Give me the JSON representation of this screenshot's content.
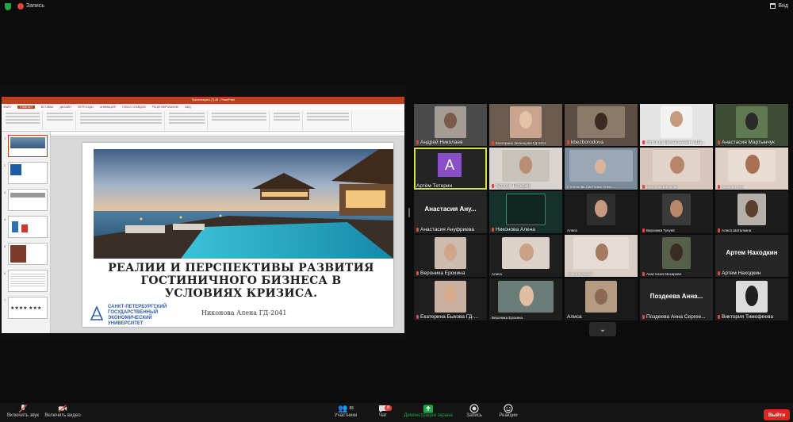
{
  "topbar": {
    "record_label": "Запись",
    "view_label": "Вид"
  },
  "ppt": {
    "window_title": "Презентация1 (7).48 - PowerPoint",
    "tabs": [
      "ФАЙЛ",
      "ГЛАВНАЯ",
      "ВСТАВКА",
      "ДИЗАЙН",
      "ПЕРЕХОДЫ",
      "АНИМАЦИЯ",
      "ПОКАЗ СЛАЙДОВ",
      "РЕЦЕНЗИРОВАНИЕ",
      "ВИД"
    ],
    "active_tab": "ГЛАВНАЯ",
    "slide_numbers": [
      "1",
      "2",
      "3",
      "4",
      "5",
      "6",
      "7"
    ],
    "slide": {
      "title": "РЕАЛИИ И ПЕРСПЕКТИВЫ РАЗВИТИЯ ГОСТИНИЧНОГО БИЗНЕСА В УСЛОВИЯХ КРИЗИСА.",
      "author": "Никонова Алена ГД-2041",
      "logo_text": "САНКТ-ПЕТЕРБУРГСКИЙ ГОСУДАРСТВЕННЫЙ ЭКОНОМИЧЕСКИЙ УНИВЕРСИТЕТ"
    }
  },
  "participants": [
    {
      "name": "Андрей Николаев"
    },
    {
      "name": "Екатерина Зеленцова ГД-1911"
    },
    {
      "name": "kbezborodova"
    },
    {
      "name": "Виктор Витальевич Ша..."
    },
    {
      "name": "Анастасия Мартынчук"
    },
    {
      "name": "Артём Тетерин",
      "initial": "A"
    },
    {
      "name": "Артем Тетерин"
    },
    {
      "name": "Степанова Светлана Алекс..."
    },
    {
      "name": "Виктория Шведова"
    },
    {
      "name": "Лаврова Анна"
    },
    {
      "name": "Анастасия Ануфриева",
      "big": "Анастасия Ану..."
    },
    {
      "name": "Никонова Алена"
    },
    {
      "name": "Алиса"
    },
    {
      "name": "Вероника Тупуев"
    },
    {
      "name": "Алиса Шаталкина"
    },
    {
      "name": "Вероника Ерохина"
    },
    {
      "name": "Алиса"
    },
    {
      "name": "Алена Бочкина"
    },
    {
      "name": "Анастасия Мохарева"
    },
    {
      "name": "Артем Находкин",
      "big": "Артем Находкин"
    },
    {
      "name": "Екатерина Быкова ГД-..."
    },
    {
      "name": "Вероника Ерохина"
    },
    {
      "name": "Алиса"
    },
    {
      "name": "Поздеева Анна Сергее...",
      "big": "Поздеева Анна..."
    },
    {
      "name": "Виктория Тимофеева"
    }
  ],
  "toolbar": {
    "unmute": "Включить звук",
    "start_video": "Включить видео",
    "participants": "Участники",
    "participants_count": "86",
    "chat": "Чат",
    "chat_badge": "8",
    "share": "Демонстрация экрана",
    "record": "Запись",
    "reactions": "Реакции",
    "leave": "Выйти"
  },
  "colors": {
    "accent_yellow": "#d9e24b",
    "leave_red": "#e0241e",
    "avatar_purple": "#8a4fc7",
    "ppt_orange": "#c43e1c"
  }
}
